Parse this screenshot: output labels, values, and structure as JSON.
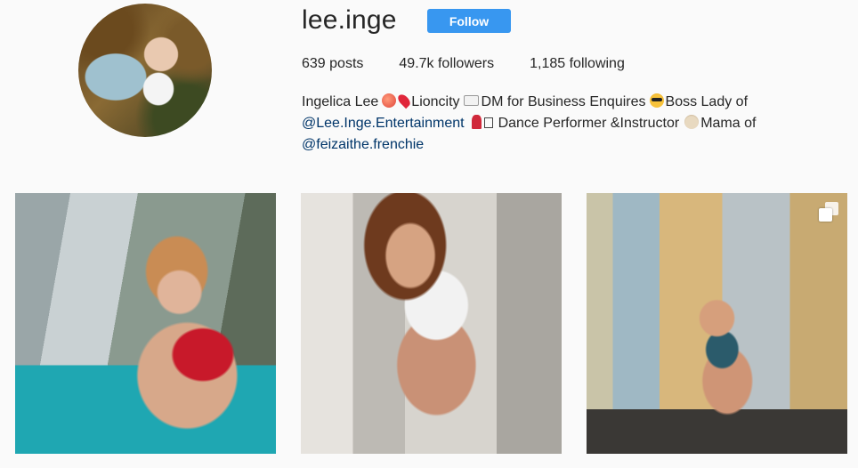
{
  "profile": {
    "username": "lee.inge",
    "follow_label": "Follow",
    "accent_color": "#3897f0"
  },
  "stats": {
    "posts": "639 posts",
    "followers": "49.7k followers",
    "following": "1,185 following"
  },
  "bio": {
    "line1": {
      "name": "Ingelica Lee",
      "location": "Lioncity",
      "dm": "DM for Business Enquires",
      "boss": "Boss Lady of"
    },
    "line2": {
      "link": "@Lee.Inge.Entertainment",
      "dance": "Dance Performer &Instructor",
      "mama": "Mama of"
    },
    "line3": {
      "link": "@feizaithe.frenchie"
    },
    "icons": [
      "peach-emoji",
      "pin-emoji",
      "envelope-emoji",
      "sunglasses-emoji",
      "dancer-emoji",
      "dog-emoji"
    ]
  },
  "posts": [
    {
      "type": "photo",
      "icon": ""
    },
    {
      "type": "photo",
      "icon": ""
    },
    {
      "type": "carousel",
      "icon": "multiple-photos-icon"
    }
  ]
}
